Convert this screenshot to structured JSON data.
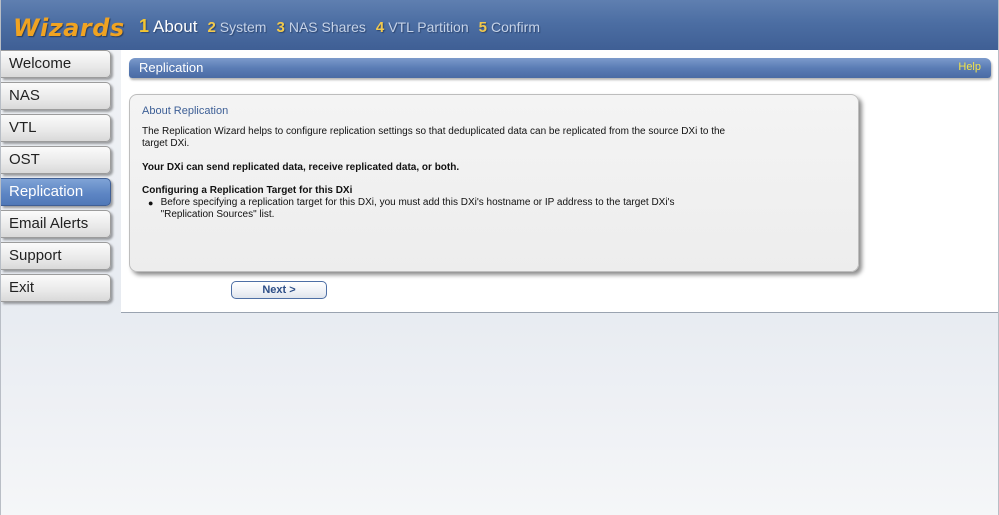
{
  "header": {
    "brand": "Wizards",
    "steps": [
      {
        "num": "1",
        "label": "About",
        "active": true
      },
      {
        "num": "2",
        "label": "System"
      },
      {
        "num": "3",
        "label": "NAS Shares"
      },
      {
        "num": "4",
        "label": "VTL Partition"
      },
      {
        "num": "5",
        "label": "Confirm"
      }
    ]
  },
  "sidebar": {
    "items": [
      {
        "label": "Welcome"
      },
      {
        "label": "NAS"
      },
      {
        "label": "VTL"
      },
      {
        "label": "OST"
      },
      {
        "label": "Replication",
        "active": true
      },
      {
        "label": "Email Alerts"
      },
      {
        "label": "Support"
      },
      {
        "label": "Exit"
      }
    ]
  },
  "main": {
    "title": "Replication",
    "help": "Help",
    "panel": {
      "heading": "About Replication",
      "intro": "The Replication Wizard helps to configure replication settings so that deduplicated data can be replicated from the source DXi to the target DXi.",
      "bold_text": "Your DXi can send replicated data, receive replicated data, or both.",
      "subheading": "Configuring a Replication Target for this DXi",
      "bullet": "Before specifying a replication target for this DXi, you must add this DXi's hostname or IP address to the target DXi's \"Replication Sources\" list."
    },
    "next_label": "Next >"
  },
  "colors": {
    "header_blue": "#4c6ea3",
    "brand_orange": "#f0a322",
    "active_nav": "#5e86c4",
    "help_yellow": "#f3e44a"
  }
}
